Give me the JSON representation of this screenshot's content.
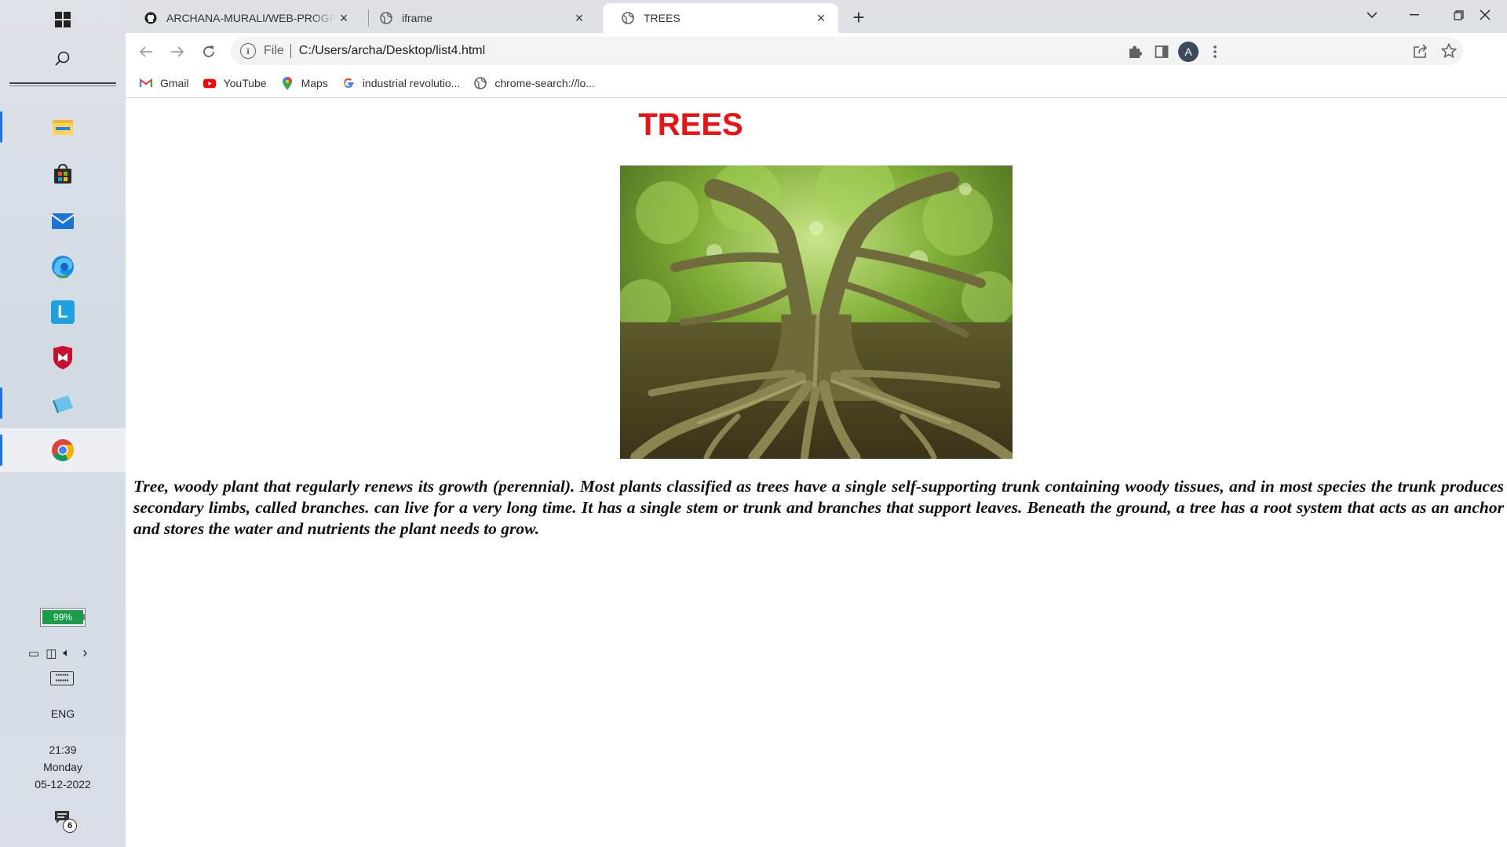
{
  "taskbar": {
    "apps": [
      {
        "name": "file-explorer"
      },
      {
        "name": "microsoft-store"
      },
      {
        "name": "mail"
      },
      {
        "name": "edge"
      },
      {
        "name": "l-app"
      },
      {
        "name": "mcafee"
      },
      {
        "name": "notepad"
      },
      {
        "name": "chrome"
      }
    ],
    "battery": "99%",
    "language": "ENG",
    "time": "21:39",
    "day": "Monday",
    "date": "05-12-2022",
    "notification_count": "6"
  },
  "browser": {
    "tabs": [
      {
        "title": "ARCHANA-MURALI/WEB-PROGRAMMING",
        "favicon": "github-icon"
      },
      {
        "title": "iframe",
        "favicon": "globe-icon"
      },
      {
        "title": "TREES",
        "favicon": "globe-icon",
        "active": true
      }
    ],
    "omnibox": {
      "scheme": "File",
      "url": "C:/Users/archa/Desktop/list4.html"
    },
    "avatar_letter": "A",
    "bookmarks": [
      {
        "label": "Gmail",
        "icon": "gmail-icon"
      },
      {
        "label": "YouTube",
        "icon": "youtube-icon"
      },
      {
        "label": "Maps",
        "icon": "maps-icon"
      },
      {
        "label": "industrial revolutio...",
        "icon": "google-icon"
      },
      {
        "label": "chrome-search://lo...",
        "icon": "globe-icon"
      }
    ]
  },
  "page": {
    "title": "TREES",
    "image_subject": "large old tree with sprawling exposed roots and green canopy",
    "description": "Tree, woody plant that regularly renews its growth (perennial). Most plants classified as trees have a single self-supporting trunk containing woody tissues, and in most species the trunk produces secondary limbs, called branches. can live for a very long time. It has a single stem or trunk and branches that support leaves. Beneath the ground, a tree has a root system that acts as an anchor and stores the water and nutrients the plant needs to grow."
  },
  "colors": {
    "title_red": "#ee1111",
    "tabstrip": "#dee1e6",
    "accent_blue": "#1a73e8",
    "battery_green": "#1a9d4a"
  }
}
